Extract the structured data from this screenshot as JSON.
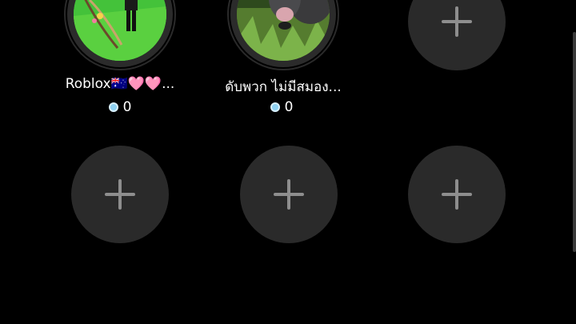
{
  "seats": [
    {
      "name": "Roblox🇦🇺🩷🩷...",
      "coins": "0",
      "avatar": "roblox-character-photo"
    },
    {
      "name": "ดับพวก ไม่มีสมอง...",
      "coins": "0",
      "avatar": "buffalo-photo"
    }
  ],
  "empty_seats": [
    {
      "icon": "plus-icon"
    },
    {
      "icon": "plus-icon"
    },
    {
      "icon": "plus-icon"
    },
    {
      "icon": "plus-icon"
    }
  ],
  "colors": {
    "background": "#000000",
    "empty_seat": "#2a2a2a",
    "plus": "#8e8e8e",
    "coin": "#8fd3f4"
  }
}
